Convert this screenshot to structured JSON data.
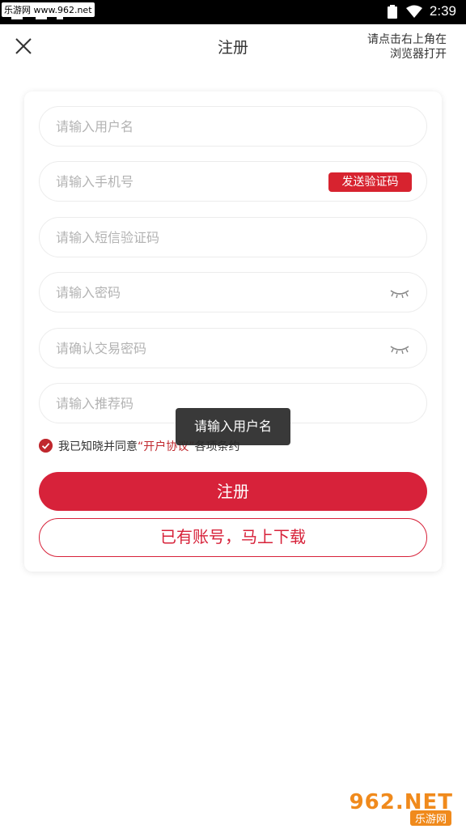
{
  "status_bar": {
    "watermark": "乐游网 www.962.net",
    "time": "2:39"
  },
  "header": {
    "title": "注册",
    "hint_line1": "请点击右上角在",
    "hint_line2": "浏览器打开"
  },
  "form": {
    "username_placeholder": "请输入用户名",
    "phone_placeholder": "请输入手机号",
    "send_code_label": "发送验证码",
    "sms_code_placeholder": "请输入短信验证码",
    "password_placeholder": "请输入密码",
    "confirm_password_placeholder": "请确认交易密码",
    "referral_placeholder": "请输入推荐码",
    "agree_prefix": "我已知晓并同意",
    "agree_link": "“开户协议”",
    "agree_suffix": "各项条约",
    "agree_checked": true,
    "register_label": "注册",
    "login_label": "已有账号，马上下载"
  },
  "toast": {
    "message": "请输入用户名"
  },
  "corner_logo": {
    "top": "962.NET",
    "bottom": "乐游网"
  },
  "colors": {
    "accent": "#d7223a",
    "toast_bg": "#282828"
  }
}
